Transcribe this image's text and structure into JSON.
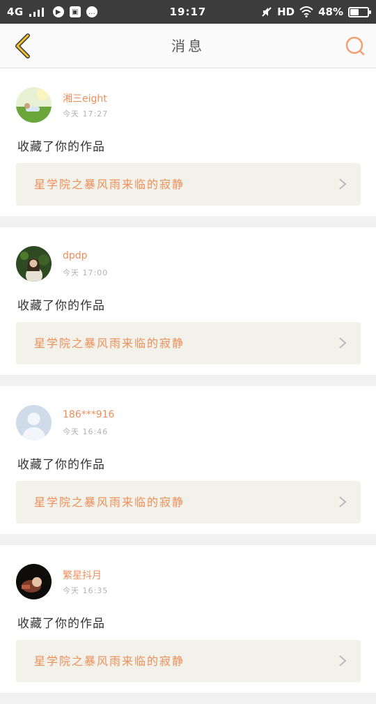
{
  "status_bar": {
    "network": "4G",
    "time": "19:17",
    "hd": "HD",
    "battery": "48%",
    "battery_level": 0.48,
    "icons": [
      "signal-icon",
      "play-icon",
      "save-icon",
      "chat-icon",
      "mute-icon",
      "wifi-icon",
      "battery-icon"
    ]
  },
  "header": {
    "title": "消息",
    "back_icon": "chevron-left-icon",
    "search_icon": "search-icon"
  },
  "colors": {
    "accent": "#ec8f5a",
    "back_icon": "#f1c230",
    "search_icon": "#f0a070",
    "card_link_bg": "#f2f1ea",
    "status_bar_bg": "#3c3c3c"
  },
  "messages": [
    {
      "user": "湘三eight",
      "time": "今天 17:27",
      "action": "收藏了你的作品",
      "work_title": "星学院之暴风雨来临的寂静",
      "avatar": "avatar-grass-photo"
    },
    {
      "user": "dpdp",
      "time": "今天 17:00",
      "action": "收藏了你的作品",
      "work_title": "星学院之暴风雨来临的寂静",
      "avatar": "avatar-girl-photo"
    },
    {
      "user": "186***916",
      "time": "今天 16:46",
      "action": "收藏了你的作品",
      "work_title": "星学院之暴风雨来临的寂静",
      "avatar": "avatar-default-person"
    },
    {
      "user": "繁星抖月",
      "time": "今天 16:35",
      "action": "收藏了你的作品",
      "work_title": "星学院之暴风雨来临的寂静",
      "avatar": "avatar-dark-photo"
    }
  ]
}
